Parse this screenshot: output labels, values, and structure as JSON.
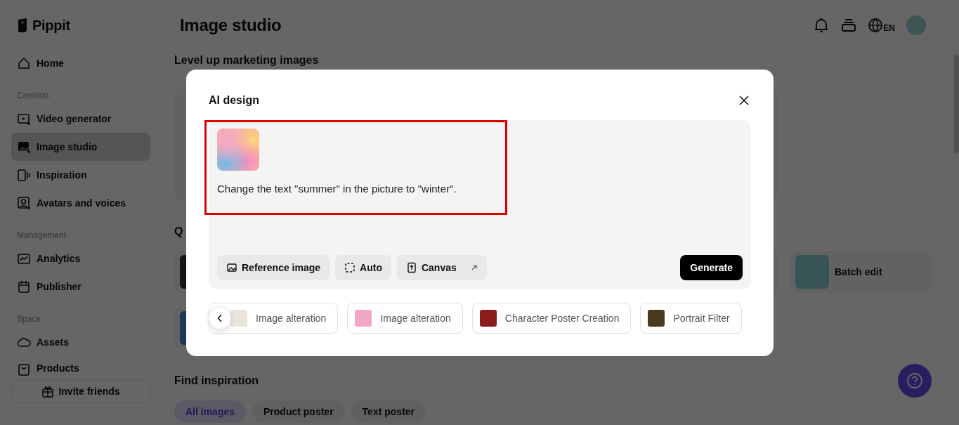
{
  "sidebar": {
    "logo": "Pippit",
    "sections": [
      {
        "items": [
          {
            "label": "Home",
            "selected": false
          }
        ]
      },
      {
        "title": "Creation",
        "items": [
          {
            "label": "Video generator",
            "selected": false
          },
          {
            "label": "Image studio",
            "selected": true
          },
          {
            "label": "Inspiration",
            "selected": false
          },
          {
            "label": "Avatars and voices",
            "selected": false
          }
        ]
      },
      {
        "title": "Management",
        "items": [
          {
            "label": "Analytics",
            "selected": false
          },
          {
            "label": "Publisher",
            "selected": false
          }
        ]
      },
      {
        "title": "Space",
        "items": [
          {
            "label": "Assets",
            "selected": false
          },
          {
            "label": "Products",
            "selected": false
          }
        ]
      }
    ],
    "invite_button": "Invite friends"
  },
  "header": {
    "title": "Image studio",
    "language": "EN"
  },
  "main": {
    "section_titles": [
      "Level up marketing images",
      "Q"
    ],
    "tool_card": {
      "label": "Batch edit"
    },
    "find_inspiration": {
      "title": "Find inspiration",
      "filters": [
        {
          "label": "All images",
          "selected": true
        },
        {
          "label": "Product poster",
          "selected": false
        },
        {
          "label": "Text poster",
          "selected": false
        }
      ]
    }
  },
  "dialog": {
    "title": "AI design",
    "prompt": "Change the text \"summer\" in the picture to \"winter\".",
    "options": [
      {
        "label": "Reference image",
        "kind": "reference"
      },
      {
        "label": "Auto",
        "kind": "auto"
      },
      {
        "label": "Canvas",
        "kind": "canvas"
      }
    ],
    "generate": "Generate",
    "suggestions": [
      {
        "label": "Image alteration",
        "color": "#e9e4de"
      },
      {
        "label": "Image alteration",
        "color": "#f2a7c9"
      },
      {
        "label": "Character Poster Creation",
        "color": "#8a1c1c"
      },
      {
        "label": "Portrait Filter",
        "color": "#4a3a22"
      }
    ]
  }
}
